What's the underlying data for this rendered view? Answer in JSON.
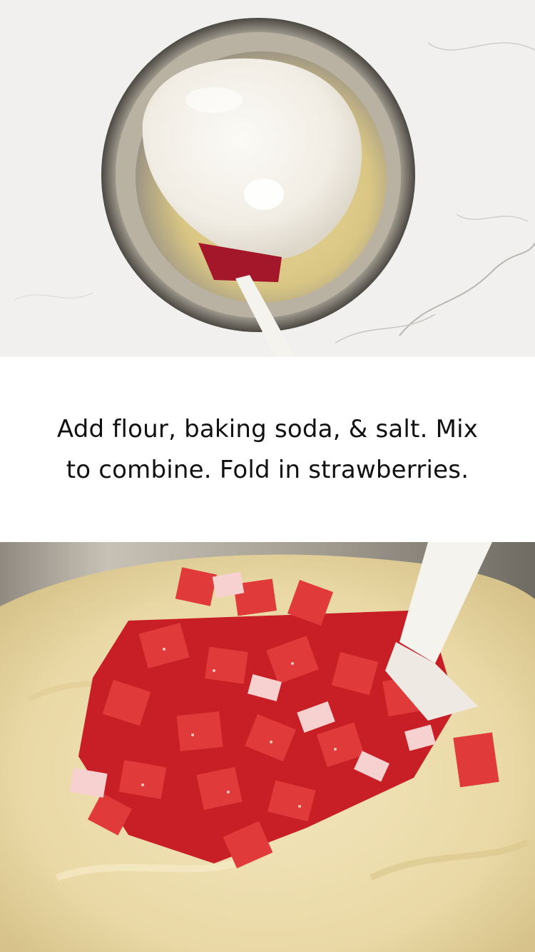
{
  "caption": {
    "line1": "Add flour, baking soda, & salt. Mix",
    "line2": "to combine. Fold in strawberries."
  },
  "colors": {
    "background": "#ffffff",
    "caption_text": "#111111",
    "marble": "#f1f0ee",
    "flour": "#f4f1ea",
    "batter": "#ead9a6",
    "strawberry": "#d6262c",
    "spatula_head": "#a4162a",
    "spatula_handle": "#f5f3ee"
  }
}
